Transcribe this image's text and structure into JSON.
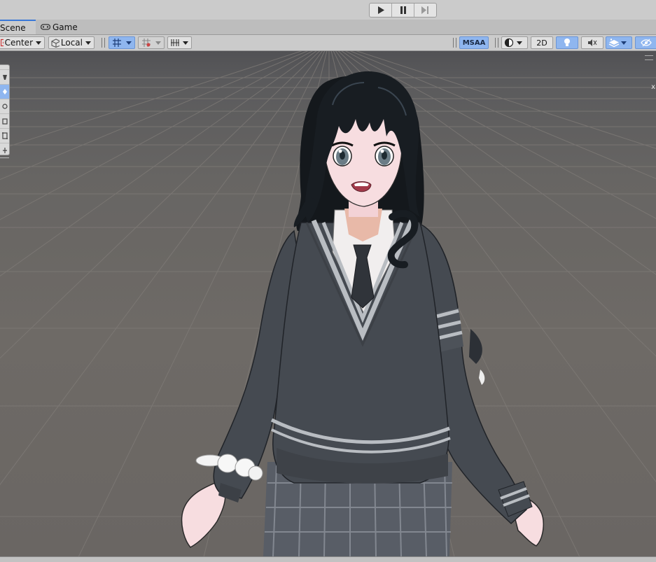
{
  "playbar": {
    "play_icon": "play-icon",
    "pause_icon": "pause-icon",
    "step_icon": "step-icon"
  },
  "tabs": [
    {
      "label": "Scene",
      "active": true
    },
    {
      "label": "Game",
      "active": false,
      "icon": "gamepad-icon"
    }
  ],
  "toolbar": {
    "pivot_label": "Center",
    "space_label": "Local",
    "msaa_label": "MSAA",
    "mode_2d_label": "2D"
  },
  "viewport": {
    "axis_label": "x"
  },
  "tools": [
    "view-tool",
    "move-tool",
    "rotate-tool",
    "scale-tool",
    "rect-tool",
    "transform-tool"
  ],
  "colors": {
    "accent": "#3a79d8",
    "toggle_on": "#8fb6ef",
    "sweater": "#454a51",
    "hair": "#14181c",
    "skin": "#f7dde0"
  }
}
